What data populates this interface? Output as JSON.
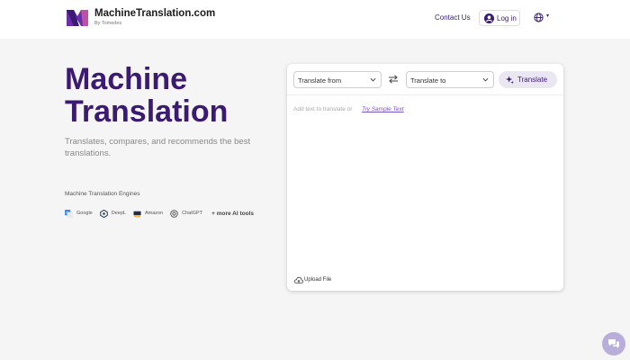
{
  "header": {
    "brand_name": "MachineTranslation.com",
    "brand_sub": "By Tomedes",
    "contact": "Contact Us",
    "login": "Log in",
    "logo_icon": "mt-logo-icon",
    "user_icon": "user-circle-icon",
    "globe_icon": "globe-icon",
    "caret": "▾"
  },
  "hero": {
    "title": "Machine Translation",
    "subtitle": "Translates, compares, and recommends the best translations.",
    "engines_label": "Machine Translation Engines",
    "engines": [
      {
        "name": "Google",
        "icon": "google-translate-icon"
      },
      {
        "name": "DeepL",
        "icon": "deepl-icon"
      },
      {
        "name": "Amazon",
        "icon": "amazon-icon"
      },
      {
        "name": "ChatGPT",
        "icon": "chatgpt-icon"
      }
    ],
    "more": "+ more AI tools"
  },
  "translator": {
    "from_label": "Translate from",
    "to_label": "Translate to",
    "translate_button": "Translate",
    "placeholder": "Add text to translate or",
    "sample_link": "Try Sample Text",
    "upload": "Upload File"
  },
  "colors": {
    "brand_purple": "#3b1a72",
    "link_purple": "#7b52c8",
    "button_bg": "#ebe7f2",
    "chat_bg": "#b9aeda",
    "page_bg": "#f5f5f5"
  }
}
